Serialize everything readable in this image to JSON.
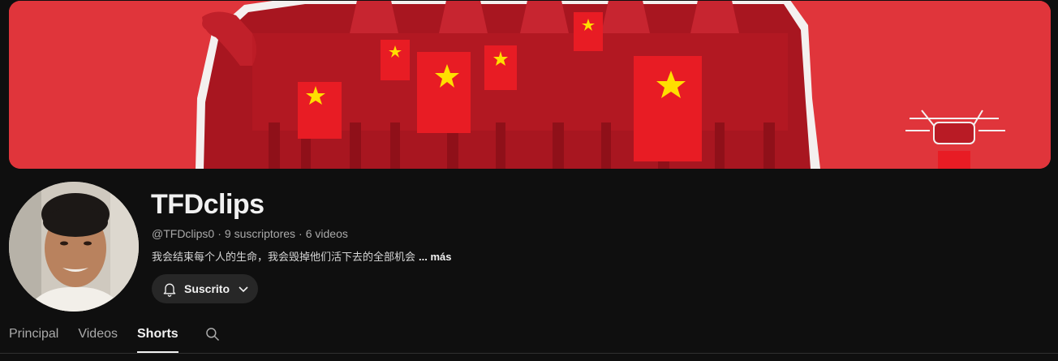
{
  "channel": {
    "name": "TFDclips",
    "handle": "@TFDclips0",
    "subscribers": "9 suscriptores",
    "videos": "6 videos",
    "separator": "·",
    "description": "我会结束每个人的生命，我会毁掉他们活下去的全部机会",
    "more_label": "... más"
  },
  "subscribe_button": {
    "label": "Suscrito",
    "icon": "bell-icon",
    "dropdown_icon": "chevron-down-icon"
  },
  "tabs": [
    {
      "label": "Principal",
      "active": false
    },
    {
      "label": "Videos",
      "active": false
    },
    {
      "label": "Shorts",
      "active": true
    }
  ],
  "colors": {
    "background": "#0f0f0f",
    "banner_red": "#e0353b",
    "text_primary": "#f1f1f1",
    "text_secondary": "#aaaaaa",
    "button_bg": "#272727",
    "flag_star": "#ffde00"
  }
}
